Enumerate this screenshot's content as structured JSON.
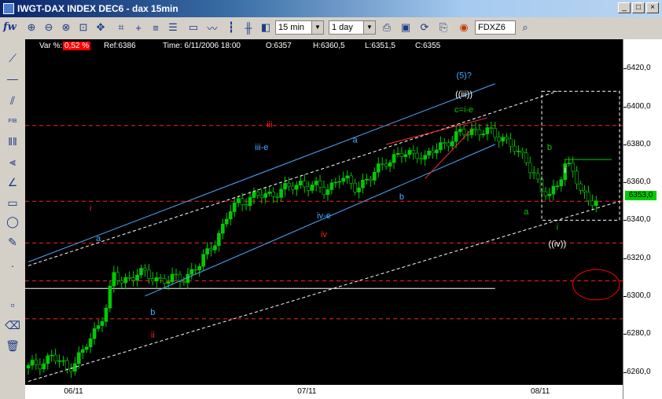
{
  "window": {
    "title": "IWGT-DAX INDEX DEC6 - dax 15min"
  },
  "toolbar": {
    "brand": "fw",
    "interval": "15 min",
    "range": "1 day",
    "symbol": "FDXZ6",
    "icons": [
      "zoom-in-icon",
      "zoom-out-icon",
      "zoom-fit-icon",
      "zoom-box-icon",
      "pan-icon",
      "crosshair-icon",
      "indicator-icon",
      "template-icon",
      "line-chart-icon",
      "candle-chart-icon",
      "bar-chart-icon",
      "color-icon",
      "print-icon",
      "save-icon",
      "refresh-icon",
      "paste-icon",
      "globe-icon",
      "search-icon"
    ]
  },
  "info": {
    "var_label": "Var %:",
    "var_value": "0,52 %",
    "ref": "Ref:6386",
    "time": "Time: 6/11/2006 18:00",
    "open": "O:6357",
    "high": "H:6360,5",
    "low": "L:6351,5",
    "close": "C:6355"
  },
  "left_tools": [
    "trendline-icon",
    "hline-icon",
    "channel-icon",
    "fibonacci-icon",
    "vlines-icon",
    "fan-icon",
    "gann-icon",
    "rectangle-icon",
    "ellipse-icon",
    "cursor-icon",
    "color-swatch-icon",
    "eraser-icon",
    "trash-icon"
  ],
  "left_tool_labels": {
    "fibonacci": "FIB"
  },
  "chart_data": {
    "type": "candlestick",
    "title": "",
    "ylim": [
      6254,
      6428
    ],
    "y_ticks": [
      "6420,0",
      "6400,0",
      "6380,0",
      "6360,0",
      "6340,0",
      "6320,0",
      "6300,0",
      "6280,0",
      "6260,0"
    ],
    "y_tick_values": [
      6420,
      6400,
      6380,
      6360,
      6340,
      6320,
      6300,
      6280,
      6260
    ],
    "x_ticks": [
      "06/11",
      "07/11",
      "08/11"
    ],
    "x_tick_bars": [
      6,
      36,
      66
    ],
    "last_price": "6353,0",
    "last_price_value": 6353,
    "close_path": [
      [
        0,
        6262
      ],
      [
        3,
        6268
      ],
      [
        5,
        6262
      ],
      [
        7,
        6270
      ],
      [
        9,
        6285
      ],
      [
        10,
        6295
      ],
      [
        11,
        6310
      ],
      [
        12,
        6308
      ],
      [
        14,
        6312
      ],
      [
        16,
        6310
      ],
      [
        18,
        6308
      ],
      [
        20,
        6310
      ],
      [
        22,
        6316
      ],
      [
        24,
        6330
      ],
      [
        25,
        6336
      ],
      [
        26,
        6345
      ],
      [
        27,
        6350
      ],
      [
        29,
        6352
      ],
      [
        31,
        6354
      ],
      [
        33,
        6356
      ],
      [
        35,
        6360
      ],
      [
        36,
        6358
      ],
      [
        38,
        6356
      ],
      [
        40,
        6362
      ],
      [
        42,
        6358
      ],
      [
        44,
        6362
      ],
      [
        46,
        6372
      ],
      [
        48,
        6374
      ],
      [
        50,
        6376
      ],
      [
        51,
        6372
      ],
      [
        53,
        6380
      ],
      [
        55,
        6384
      ],
      [
        57,
        6388
      ],
      [
        59,
        6386
      ],
      [
        61,
        6384
      ],
      [
        62,
        6380
      ],
      [
        63,
        6374
      ],
      [
        64,
        6372
      ],
      [
        65,
        6365
      ],
      [
        66,
        6355
      ],
      [
        67,
        6352
      ],
      [
        68,
        6360
      ],
      [
        69,
        6370
      ],
      [
        70,
        6365
      ],
      [
        71,
        6355
      ],
      [
        72,
        6352
      ],
      [
        73,
        6350
      ]
    ],
    "horizontal_levels": [
      {
        "value": 6390,
        "style": "dashed",
        "color": "#ff2020"
      },
      {
        "value": 6350,
        "style": "dashed",
        "color": "#ff2020"
      },
      {
        "value": 6328,
        "style": "dashed",
        "color": "#ff2020"
      },
      {
        "value": 6308,
        "style": "dashed",
        "color": "#ff2020"
      },
      {
        "value": 6288,
        "style": "dashed",
        "color": "#ff2020"
      },
      {
        "value": 6304,
        "style": "solid",
        "color": "#ffffff",
        "x_end_bar": 60
      }
    ],
    "trend_lines": [
      {
        "color": "#4aaaff",
        "style": "solid",
        "from": [
          0,
          6318
        ],
        "to": [
          60,
          6412
        ]
      },
      {
        "color": "#4aaaff",
        "style": "solid",
        "from": [
          15,
          6300
        ],
        "to": [
          60,
          6380
        ]
      },
      {
        "color": "#ffffff",
        "style": "dashed",
        "from": [
          0,
          6316
        ],
        "to": [
          68,
          6408
        ]
      },
      {
        "color": "#ffffff",
        "style": "dashed",
        "from": [
          0,
          6255
        ],
        "to": [
          76,
          6350
        ]
      },
      {
        "color": "#ff3030",
        "style": "solid",
        "from": [
          46,
          6380
        ],
        "to": [
          59,
          6394
        ]
      },
      {
        "color": "#ff3030",
        "style": "solid",
        "from": [
          51,
          6362
        ],
        "to": [
          57,
          6388
        ]
      },
      {
        "color": "#00cc00",
        "style": "solid",
        "from": [
          69,
          6372
        ],
        "to": [
          75,
          6372
        ]
      }
    ],
    "dashed_box": {
      "color": "#ffffff",
      "from": [
        66,
        6408
      ],
      "to": [
        76,
        6340
      ]
    },
    "ellipse": {
      "color": "#ff0000",
      "center": [
        73,
        6306
      ],
      "radius_bars": 3,
      "radius_value": 8
    },
    "annotations": [
      {
        "text": "(5)?",
        "bar": 56,
        "value": 6415,
        "color": "#4aaaff"
      },
      {
        "text": "((iii))",
        "bar": 56,
        "value": 6405,
        "color": "#ffffff"
      },
      {
        "text": "c=i-e",
        "bar": 56,
        "value": 6397,
        "color": "#00cc00"
      },
      {
        "text": "iii",
        "bar": 31,
        "value": 6389,
        "color": "#ff2020"
      },
      {
        "text": "iii-e",
        "bar": 30,
        "value": 6377,
        "color": "#4aaaff"
      },
      {
        "text": "a",
        "bar": 42,
        "value": 6381,
        "color": "#4aaaff"
      },
      {
        "text": "b",
        "bar": 48,
        "value": 6351,
        "color": "#4aaaff"
      },
      {
        "text": "i",
        "bar": 8,
        "value": 6345,
        "color": "#ff2020"
      },
      {
        "text": "a",
        "bar": 9,
        "value": 6329,
        "color": "#4aaaff"
      },
      {
        "text": "iv-e",
        "bar": 38,
        "value": 6341,
        "color": "#4aaaff"
      },
      {
        "text": "iv",
        "bar": 38,
        "value": 6331,
        "color": "#ff2020"
      },
      {
        "text": "b",
        "bar": 16,
        "value": 6290,
        "color": "#4aaaff"
      },
      {
        "text": "ii",
        "bar": 16,
        "value": 6278,
        "color": "#ff2020"
      },
      {
        "text": "b",
        "bar": 67,
        "value": 6377,
        "color": "#00cc00"
      },
      {
        "text": "i",
        "bar": 69,
        "value": 6365,
        "color": "#ffffff"
      },
      {
        "text": "a",
        "bar": 64,
        "value": 6343,
        "color": "#00cc00"
      },
      {
        "text": "i",
        "bar": 68,
        "value": 6335,
        "color": "#00cc00"
      },
      {
        "text": "((iv))",
        "bar": 68,
        "value": 6326,
        "color": "#ffffff"
      }
    ]
  }
}
